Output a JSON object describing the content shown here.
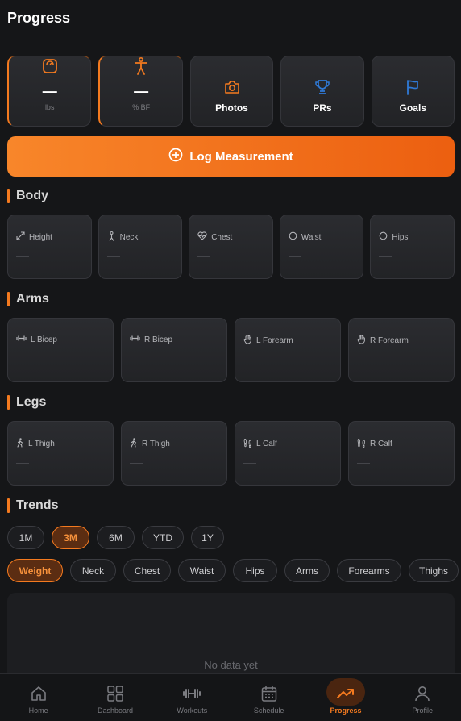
{
  "header": {
    "title": "Progress"
  },
  "stats": [
    {
      "icon": "scale-icon",
      "value": "—",
      "unit": "lbs"
    },
    {
      "icon": "body-figure-icon",
      "value": "—",
      "unit": "% BF"
    }
  ],
  "quick_links": [
    {
      "icon": "camera-icon",
      "label": "Photos"
    },
    {
      "icon": "trophy-icon",
      "label": "PRs"
    },
    {
      "icon": "flag-icon",
      "label": "Goals"
    }
  ],
  "log_button": {
    "label": "Log Measurement"
  },
  "sections": {
    "body": {
      "title": "Body",
      "items": [
        {
          "icon": "ruler-diagonal-icon",
          "label": "Height",
          "value": "—"
        },
        {
          "icon": "person-icon",
          "label": "Neck",
          "value": "—"
        },
        {
          "icon": "heart-icon",
          "label": "Chest",
          "value": "—"
        },
        {
          "icon": "circle-icon",
          "label": "Waist",
          "value": "—"
        },
        {
          "icon": "circle-icon",
          "label": "Hips",
          "value": "—"
        }
      ]
    },
    "arms": {
      "title": "Arms",
      "items": [
        {
          "icon": "dumbbell-icon",
          "label": "L Bicep",
          "value": "—"
        },
        {
          "icon": "dumbbell-icon",
          "label": "R Bicep",
          "value": "—"
        },
        {
          "icon": "hand-icon",
          "label": "L Forearm",
          "value": "—"
        },
        {
          "icon": "hand-icon",
          "label": "R Forearm",
          "value": "—"
        }
      ]
    },
    "legs": {
      "title": "Legs",
      "items": [
        {
          "icon": "walking-icon",
          "label": "L Thigh",
          "value": "—"
        },
        {
          "icon": "walking-icon",
          "label": "R Thigh",
          "value": "—"
        },
        {
          "icon": "footprints-icon",
          "label": "L Calf",
          "value": "—"
        },
        {
          "icon": "footprints-icon",
          "label": "R Calf",
          "value": "—"
        }
      ]
    }
  },
  "trends": {
    "title": "Trends",
    "ranges": [
      "1M",
      "3M",
      "6M",
      "YTD",
      "1Y"
    ],
    "selected_range": "3M",
    "metrics": [
      "Weight",
      "Neck",
      "Chest",
      "Waist",
      "Hips",
      "Arms",
      "Forearms",
      "Thighs"
    ],
    "selected_metric": "Weight",
    "empty_text": "No data yet"
  },
  "nav": {
    "items": [
      {
        "icon": "home-icon",
        "label": "Home"
      },
      {
        "icon": "dashboard-grid-icon",
        "label": "Dashboard"
      },
      {
        "icon": "dumbbell-icon",
        "label": "Workouts"
      },
      {
        "icon": "calendar-icon",
        "label": "Schedule"
      },
      {
        "icon": "trending-up-icon",
        "label": "Progress"
      },
      {
        "icon": "user-icon",
        "label": "Profile"
      }
    ],
    "active": "Progress"
  },
  "colors": {
    "accent": "#f47a1f",
    "background": "#151618",
    "card": "#26272b",
    "link_icon": "#2f7ad8"
  }
}
